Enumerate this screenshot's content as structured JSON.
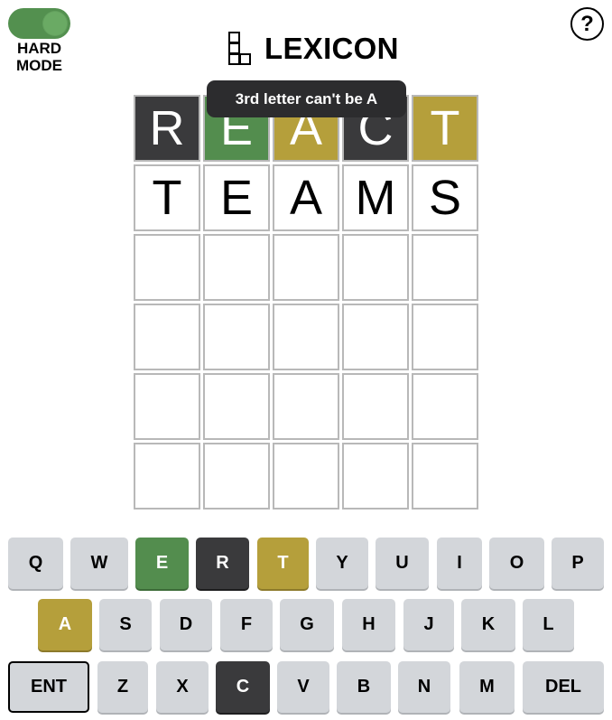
{
  "header": {
    "toggle_label_line1": "HARD",
    "toggle_label_line2": "MODE",
    "toggle_on": true,
    "title": "LEXICON",
    "help_label": "?"
  },
  "toast": "3rd letter can't be A",
  "board": {
    "rows": [
      [
        {
          "letter": "R",
          "state": "absent"
        },
        {
          "letter": "E",
          "state": "correct"
        },
        {
          "letter": "A",
          "state": "present"
        },
        {
          "letter": "C",
          "state": "absent"
        },
        {
          "letter": "T",
          "state": "present"
        }
      ],
      [
        {
          "letter": "T",
          "state": "empty"
        },
        {
          "letter": "E",
          "state": "empty"
        },
        {
          "letter": "A",
          "state": "empty"
        },
        {
          "letter": "M",
          "state": "empty"
        },
        {
          "letter": "S",
          "state": "empty"
        }
      ],
      [
        {
          "letter": "",
          "state": "empty"
        },
        {
          "letter": "",
          "state": "empty"
        },
        {
          "letter": "",
          "state": "empty"
        },
        {
          "letter": "",
          "state": "empty"
        },
        {
          "letter": "",
          "state": "empty"
        }
      ],
      [
        {
          "letter": "",
          "state": "empty"
        },
        {
          "letter": "",
          "state": "empty"
        },
        {
          "letter": "",
          "state": "empty"
        },
        {
          "letter": "",
          "state": "empty"
        },
        {
          "letter": "",
          "state": "empty"
        }
      ],
      [
        {
          "letter": "",
          "state": "empty"
        },
        {
          "letter": "",
          "state": "empty"
        },
        {
          "letter": "",
          "state": "empty"
        },
        {
          "letter": "",
          "state": "empty"
        },
        {
          "letter": "",
          "state": "empty"
        }
      ],
      [
        {
          "letter": "",
          "state": "empty"
        },
        {
          "letter": "",
          "state": "empty"
        },
        {
          "letter": "",
          "state": "empty"
        },
        {
          "letter": "",
          "state": "empty"
        },
        {
          "letter": "",
          "state": "empty"
        }
      ]
    ]
  },
  "keyboard": {
    "rows": [
      [
        {
          "label": "Q",
          "state": ""
        },
        {
          "label": "W",
          "state": ""
        },
        {
          "label": "E",
          "state": "correct"
        },
        {
          "label": "R",
          "state": "absent"
        },
        {
          "label": "T",
          "state": "present"
        },
        {
          "label": "Y",
          "state": ""
        },
        {
          "label": "U",
          "state": ""
        },
        {
          "label": "I",
          "state": ""
        },
        {
          "label": "O",
          "state": ""
        },
        {
          "label": "P",
          "state": ""
        }
      ],
      [
        {
          "label": "A",
          "state": "present"
        },
        {
          "label": "S",
          "state": ""
        },
        {
          "label": "D",
          "state": ""
        },
        {
          "label": "F",
          "state": ""
        },
        {
          "label": "G",
          "state": ""
        },
        {
          "label": "H",
          "state": ""
        },
        {
          "label": "J",
          "state": ""
        },
        {
          "label": "K",
          "state": ""
        },
        {
          "label": "L",
          "state": ""
        }
      ],
      [
        {
          "label": "ENT",
          "state": "wide-selected"
        },
        {
          "label": "Z",
          "state": ""
        },
        {
          "label": "X",
          "state": ""
        },
        {
          "label": "C",
          "state": "absent"
        },
        {
          "label": "V",
          "state": ""
        },
        {
          "label": "B",
          "state": ""
        },
        {
          "label": "N",
          "state": ""
        },
        {
          "label": "M",
          "state": ""
        },
        {
          "label": "DEL",
          "state": "wide"
        }
      ]
    ]
  }
}
